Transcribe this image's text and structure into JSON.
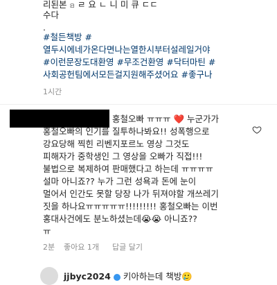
{
  "post": {
    "partial_top": "리된본 ꤤ ㄹ 요 ㄴ 니 미 큐 ㄷㄷ",
    "line_cont": "수다",
    "dot": ".",
    "tags": [
      "#철든책방 #",
      "열두시에네가온다면나는열한시부터설레일거야",
      "#이런문장도대환영 #무조건환영 #닥터마틴 #",
      "사회공헌팀에서모든걸지원해주셨어요 #좋구나"
    ],
    "time": "1시간"
  },
  "comment": {
    "lines": [
      "홍철오빠 ㅠㅠㅠ ❤️ 누군가가",
      "홍철오빠의 인기를 질투하나봐요!! 성폭행으로",
      "강요당해 찍힌 리벤지포르노 영상 그것도",
      "피해자가 중학생인 그 영상을 오빠가 직접!!!",
      "불법으로 복제하여 판매했다고 하는데 ㅠㅠㅠㅠ",
      "설마 아니죠?? 누가 그런 성욕과 돈에 눈이",
      "멀어서 인간도 못할 당장 나가 뒤져야할 개쓰레기",
      "짓을 하나요ㅠㅠㅠㅠㅠ!!!!!!!!! 홍철오빠는 이번",
      "홍대사건에도 분노하셨는데😭😭 아니죠??",
      "ㅠ"
    ],
    "time": "2분",
    "likes": "좋아요 1개",
    "reply": "답글 달기"
  },
  "next_comment": {
    "username": "jjbyc2024",
    "text": "키아하는데 책방🥲"
  },
  "colors": {
    "hashtag": "#00376b",
    "meta": "#8e8e8e"
  },
  "icons": {
    "like": "heart-outline-icon",
    "verified": "verified-badge-icon"
  }
}
